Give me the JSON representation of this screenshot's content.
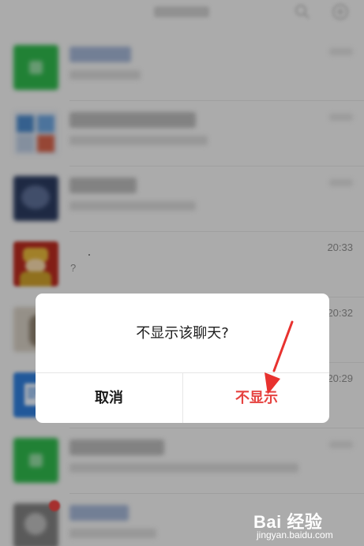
{
  "chat_list": {
    "rows": [
      {
        "time": ""
      },
      {
        "time": ""
      },
      {
        "time": ""
      },
      {
        "time": "20:33",
        "preview": "?"
      },
      {
        "time": "20:32"
      },
      {
        "time": "20:29"
      },
      {
        "time": ""
      },
      {
        "time": ""
      }
    ]
  },
  "dialog": {
    "message": "不显示该聊天?",
    "cancel_label": "取消",
    "confirm_label": "不显示",
    "confirm_color": "#e64340"
  },
  "annotation": {
    "arrow_color": "#e8322f"
  },
  "watermark": {
    "logo": "Bai 经验",
    "url": "jingyan.baidu.com"
  }
}
